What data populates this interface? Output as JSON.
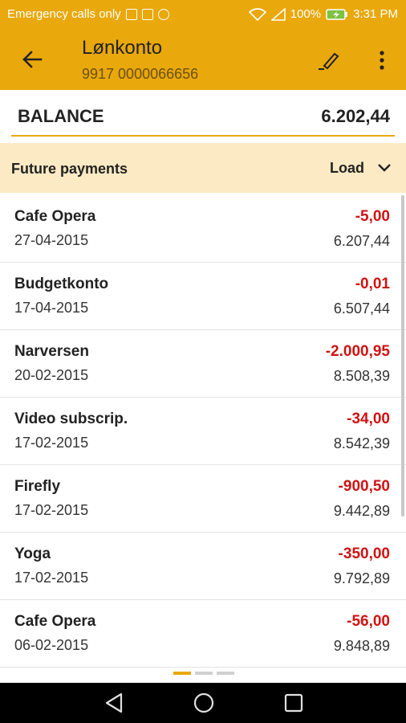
{
  "status_bar": {
    "carrier_text": "Emergency calls only",
    "battery": "100%",
    "time": "3:31 PM"
  },
  "header": {
    "title": "Lønkonto",
    "account_number": "9917 0000066656"
  },
  "balance": {
    "label": "BALANCE",
    "value": "6.202,44"
  },
  "future_payments": {
    "label": "Future payments",
    "load_label": "Load"
  },
  "transactions": [
    {
      "name": "Cafe Opera",
      "date": "27-04-2015",
      "amount": "-5,00",
      "balance": "6.207,44"
    },
    {
      "name": "Budgetkonto",
      "date": "17-04-2015",
      "amount": "-0,01",
      "balance": "6.507,44"
    },
    {
      "name": "Narversen",
      "date": "20-02-2015",
      "amount": "-2.000,95",
      "balance": "8.508,39"
    },
    {
      "name": "Video subscrip.",
      "date": "17-02-2015",
      "amount": "-34,00",
      "balance": "8.542,39"
    },
    {
      "name": "Firefly",
      "date": "17-02-2015",
      "amount": "-900,50",
      "balance": "9.442,89"
    },
    {
      "name": "Yoga",
      "date": "17-02-2015",
      "amount": "-350,00",
      "balance": "9.792,89"
    },
    {
      "name": "Cafe Opera",
      "date": "06-02-2015",
      "amount": "-56,00",
      "balance": "9.848,89"
    }
  ],
  "pager": {
    "pages": 3,
    "active": 1
  },
  "colors": {
    "brand": "#e9a80c",
    "future_bg": "#fbeac4",
    "negative_amount": "#d01212"
  },
  "icons": {
    "back": "arrow-back-icon",
    "edit": "pencil-icon",
    "more": "more-vert-icon",
    "load": "chevron-down-icon"
  }
}
